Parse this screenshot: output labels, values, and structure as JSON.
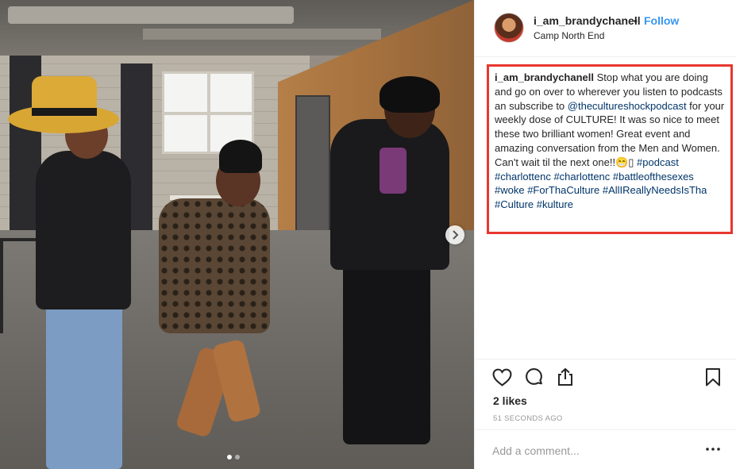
{
  "post": {
    "username": "i_am_brandychanell",
    "bullet": "•",
    "follow_label": "Follow",
    "location": "Camp North End",
    "caption": {
      "user": "i_am_brandychanell",
      "text1": " Stop what you are doing and go on over to wherever you listen to podcasts an subscribe to ",
      "mention": "@thecultureshockpodcast",
      "text2": " for your weekly dose of CULTURE! It was so nice to meet these two brilliant women! Great event and amazing conversation from the Men and Women. Can't wait til the next one!!",
      "emoji": "😁",
      "emoji2": "▯",
      "hashtags": [
        "#podcast",
        "#charlottenc",
        "#charlottenc",
        "#battleofthesexes",
        "#woke",
        "#ForThaCulture",
        "#AllIReallyNeedsIsTha",
        "#Culture",
        "#kulture"
      ]
    },
    "likes": "2 likes",
    "time_ago": "51 SECONDS AGO",
    "comment_placeholder": "Add a comment...",
    "carousel": {
      "slide_count": 2,
      "active_index": 0
    }
  },
  "icons": {
    "like": "heart-icon",
    "comment": "comment-bubble-icon",
    "share": "share-icon",
    "save": "bookmark-icon",
    "next": "chevron-right-icon",
    "more": "more-options-icon"
  },
  "colors": {
    "follow": "#3897f0",
    "link": "#003569",
    "highlight_box": "#e8372f"
  }
}
